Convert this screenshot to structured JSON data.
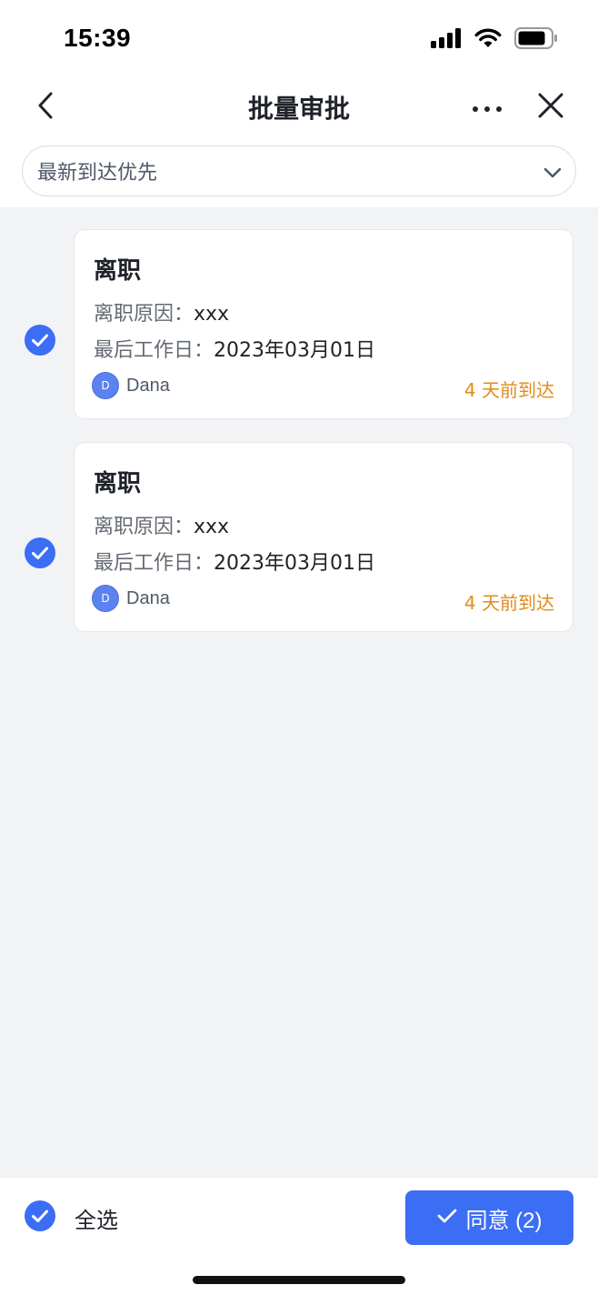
{
  "status_bar": {
    "time": "15:39",
    "icons": [
      "signal-icon",
      "wifi-icon",
      "battery-icon"
    ]
  },
  "nav": {
    "title": "批量审批",
    "icons": [
      "back-arrow-icon",
      "more-icon",
      "close-icon"
    ]
  },
  "sort": {
    "selected": "最新到达优先",
    "icon": "chevron-down-icon"
  },
  "cards": [
    {
      "checked": true,
      "title": "离职",
      "reason_label": "离职原因：",
      "reason_value": "xxx",
      "lastday_label": "最后工作日：",
      "lastday_value": "2023年03月01日",
      "avatar_initial": "D",
      "applicant": "Dana",
      "arrival": "4 天前到达"
    },
    {
      "checked": true,
      "title": "离职",
      "reason_label": "离职原因：",
      "reason_value": "xxx",
      "lastday_label": "最后工作日：",
      "lastday_value": "2023年03月01日",
      "avatar_initial": "D",
      "applicant": "Dana",
      "arrival": "4 天前到达"
    }
  ],
  "bottom": {
    "select_all_label": "全选",
    "select_all_checked": true,
    "approve_label": "同意 (2)"
  },
  "colors": {
    "accent": "#3c6df5",
    "arrival": "#e28a1a",
    "list_background": "#f2f3f5"
  }
}
